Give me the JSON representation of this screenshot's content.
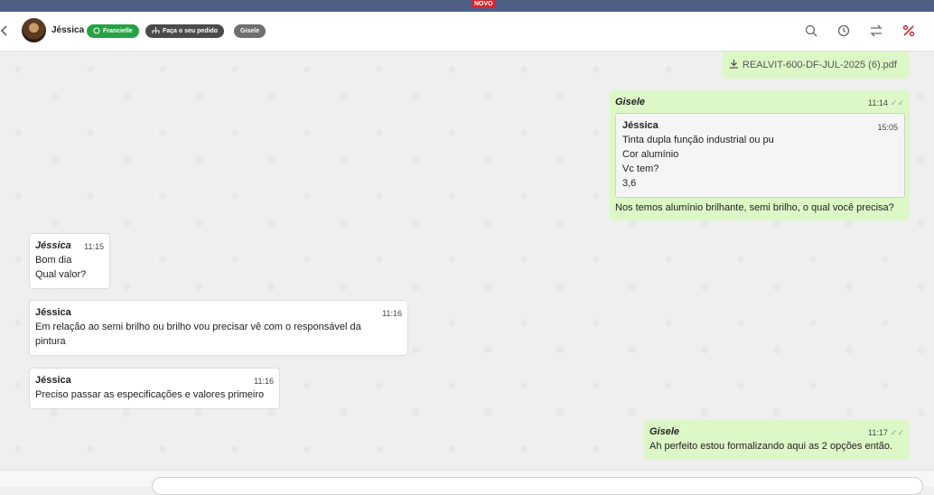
{
  "banner": {
    "badge": "NOVO"
  },
  "header": {
    "contact_name": "Jéssica",
    "tags": [
      "Francielle",
      "Faça o seu pedido",
      "Gisele"
    ],
    "icons": [
      "search-icon",
      "history-icon",
      "transfer-icon",
      "percent-icon"
    ],
    "colors": {
      "tag_green": "#25a244",
      "tag_dark": "#4a4a4a",
      "tag_gray": "#6f6f6f",
      "accent_red": "#d6282f"
    }
  },
  "attachment": {
    "filename": "REALVIT-600-DF-JUL-2025 (6).pdf"
  },
  "messages": [
    {
      "sender": "Gisele",
      "time": "11:14",
      "quote": {
        "sender": "Jéssica",
        "time": "15:05",
        "lines": [
          "Tinta dupla função industrial ou pu",
          "Cor alumínio",
          "Vc tem?",
          "3,6"
        ]
      },
      "text": "Nos temos alumínio brilhante, semi brilho, o qual você precisa?"
    },
    {
      "sender": "Jéssica",
      "time": "11:15",
      "lines": [
        "Bom dia",
        "Qual valor?"
      ]
    },
    {
      "sender": "Jéssica",
      "time": "11:16",
      "lines": [
        "Em relação ao semi brilho ou brilho vou precisar vê com o responsável da",
        "pintura"
      ]
    },
    {
      "sender": "Jéssica",
      "time": "11:16",
      "lines": [
        "Preciso passar as especificações e valores primeiro"
      ]
    },
    {
      "sender": "Gisele",
      "time": "11:17",
      "text": "Ah perfeito estou formalizando aqui as 2 opções então."
    }
  ]
}
